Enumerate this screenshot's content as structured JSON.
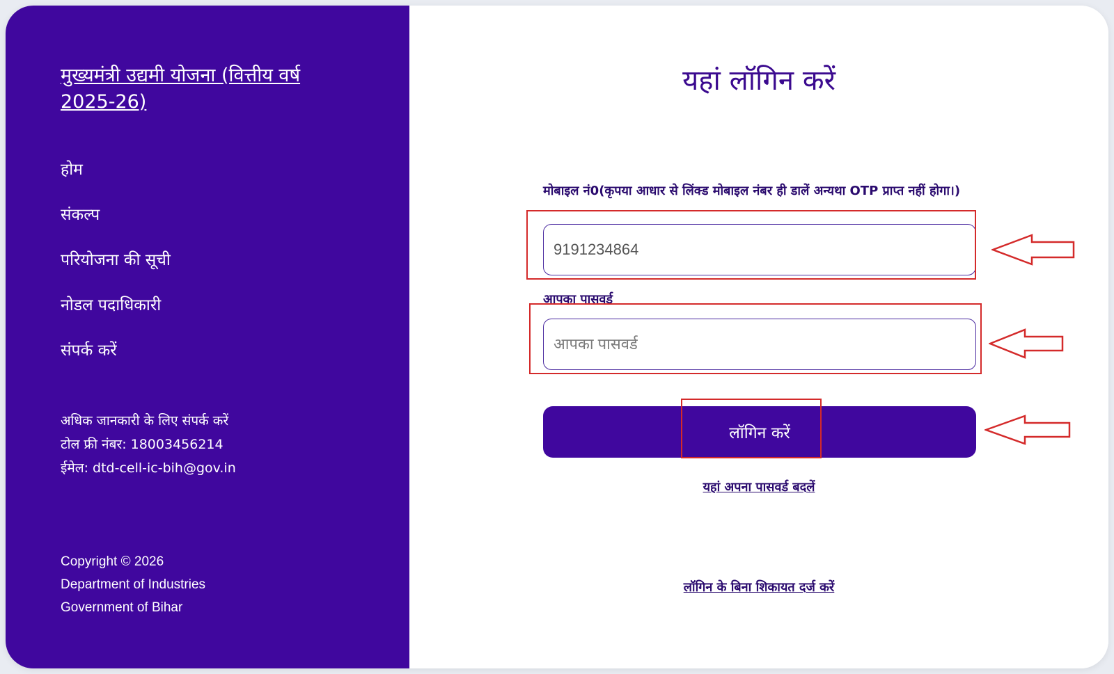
{
  "sidebar": {
    "scheme_title": "मुख्यमंत्री उद्यमी योजना (वित्तीय वर्ष 2025-26)",
    "nav_items": [
      {
        "label": "होम"
      },
      {
        "label": "संकल्प"
      },
      {
        "label": "परियोजना की सूची"
      },
      {
        "label": "नोडल पदाधिकारी"
      },
      {
        "label": "संपर्क करें"
      }
    ],
    "contact": {
      "heading": "अधिक जानकारी के लिए संपर्क करें",
      "toll_free": "टोल फ्री नंबर: 18003456214",
      "email": "ईमेल: dtd-cell-ic-bih@gov.in"
    },
    "copyright": {
      "line1": "Copyright © 2026",
      "line2": "Department of Industries",
      "line3": "Government of Bihar"
    }
  },
  "login": {
    "heading": "यहां लॉगिन करें",
    "mobile_label": "मोबाइल नं0(कृपया आधार से लिंक्ड मोबाइल नंबर ही डालें अन्यथा OTP प्राप्त नहीं होगा।)",
    "mobile_value": "9191234864",
    "password_label": "आपका पासवर्ड",
    "password_placeholder": "आपका पासवर्ड",
    "login_button": "लॉगिन करें",
    "change_password_link": "यहां अपना पासवर्ड बदलें",
    "complaint_link": "लॉगिन के बिना शिकायत दर्ज करें"
  },
  "colors": {
    "sidebar_bg": "#40079e",
    "accent": "#40079e",
    "annotation": "#d42a2a"
  }
}
